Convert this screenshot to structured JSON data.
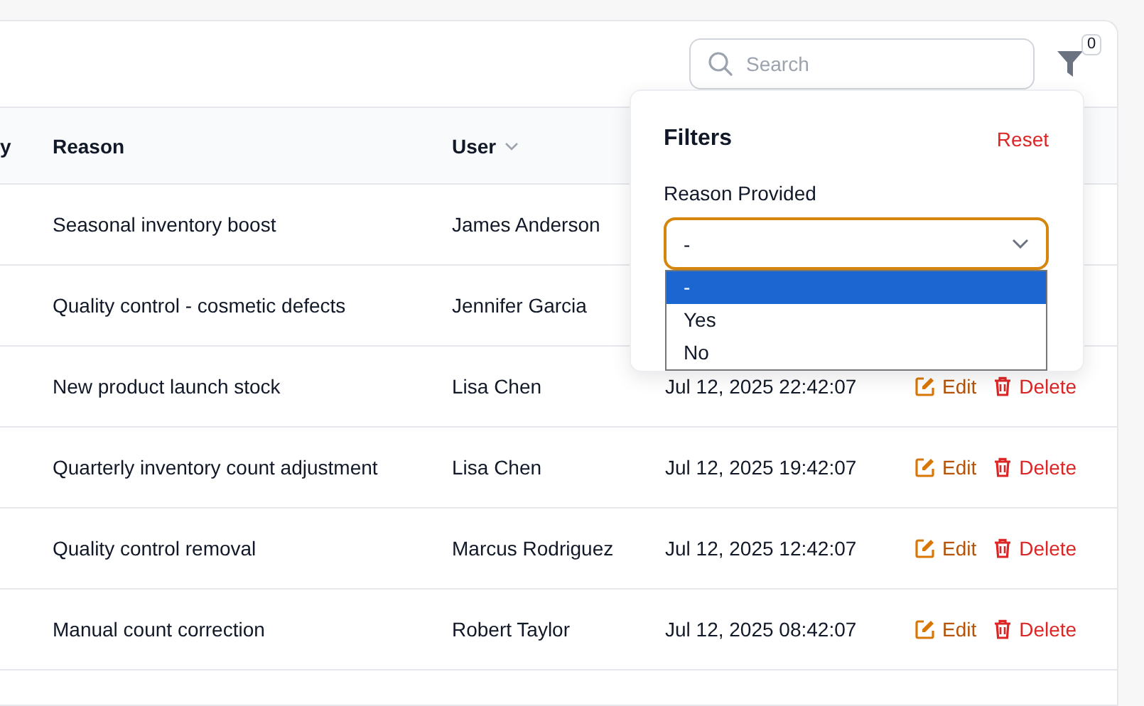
{
  "toolbar": {
    "search": {
      "placeholder": "Search"
    },
    "filter_count": "0"
  },
  "table": {
    "columns": [
      {
        "label": "y",
        "sortable": false
      },
      {
        "label": "Reason",
        "sortable": false
      },
      {
        "label": "User",
        "sortable": true
      }
    ],
    "rows": [
      {
        "reason": "Seasonal inventory boost",
        "user": "James Anderson"
      },
      {
        "reason": "Quality control - cosmetic defects",
        "user": "Jennifer Garcia"
      },
      {
        "reason": "New product launch stock",
        "user": "Lisa Chen",
        "date": "Jul 12, 2025 22:42:07",
        "actions": [
          {
            "kind": "edit",
            "label": "Edit"
          },
          {
            "kind": "delete",
            "label": "Delete"
          }
        ]
      },
      {
        "reason": "Quarterly inventory count adjustment",
        "user": "Lisa Chen",
        "date": "Jul 12, 2025 19:42:07",
        "actions": [
          {
            "kind": "edit",
            "label": "Edit"
          },
          {
            "kind": "delete",
            "label": "Delete"
          }
        ]
      },
      {
        "reason": "Quality control removal",
        "user": "Marcus Rodriguez",
        "date": "Jul 12, 2025 12:42:07",
        "actions": [
          {
            "kind": "edit",
            "label": "Edit"
          },
          {
            "kind": "delete",
            "label": "Delete"
          }
        ]
      },
      {
        "reason": "Manual count correction",
        "user": "Robert Taylor",
        "date": "Jul 12, 2025 08:42:07",
        "actions": [
          {
            "kind": "edit",
            "label": "Edit"
          },
          {
            "kind": "delete",
            "label": "Delete"
          }
        ]
      }
    ]
  },
  "filters": {
    "title": "Filters",
    "reset": "Reset",
    "field_label": "Reason Provided",
    "select": {
      "value": "-",
      "expanded": true,
      "options": [
        {
          "label": "-",
          "selected": true
        },
        {
          "label": "Yes",
          "selected": false
        },
        {
          "label": "No",
          "selected": false
        }
      ]
    }
  }
}
